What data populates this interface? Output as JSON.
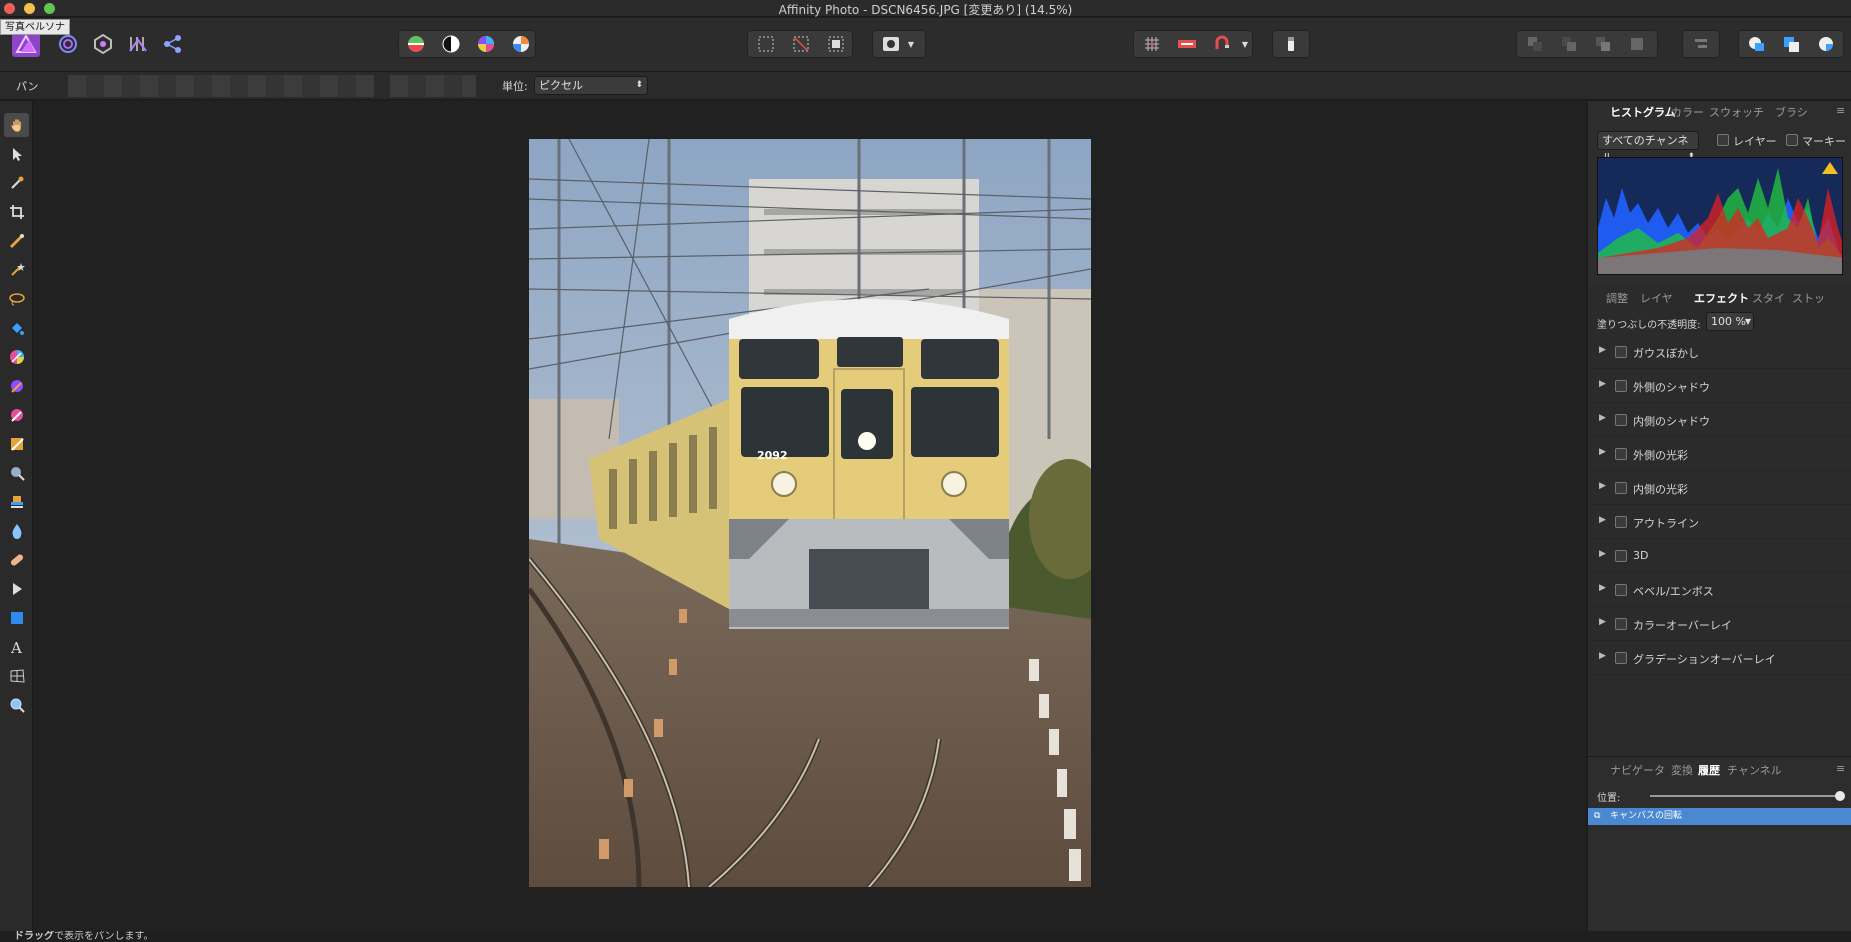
{
  "window": {
    "title": "Affinity Photo - DSCN6456.JPG [変更あり] (14.5%)",
    "tooltip": "写真ペルソナ",
    "colors": {
      "close": "#ec5f56",
      "minimize": "#f4bf4f",
      "maximize": "#61c554",
      "accent": "#4a90d9"
    }
  },
  "toolbar": {
    "persona_icons": [
      "photo-persona-icon",
      "liquify-persona-icon",
      "develop-persona-icon",
      "tone-mapping-persona-icon",
      "export-persona-icon"
    ],
    "adjust_icons": [
      "auto-levels-icon",
      "auto-contrast-icon",
      "auto-colors-icon",
      "auto-white-balance-icon"
    ],
    "selection_icons": [
      "select-all-icon",
      "deselect-icon",
      "invert-selection-icon"
    ],
    "mask_icons": [
      "quick-mask-icon"
    ],
    "snapping_icons": [
      "grid-icon",
      "assistant-icon",
      "snapping-icon"
    ],
    "misc_icons": [
      "force-pixel-alignment-icon"
    ],
    "arrange_icons": [
      "move-to-back-icon",
      "move-back-icon",
      "move-forward-icon",
      "move-to-front-icon"
    ],
    "align_icons": [
      "align-icon"
    ],
    "boolean_icons": [
      "add-icon",
      "subtract-icon",
      "intersect-icon"
    ]
  },
  "context": {
    "mode": "パン",
    "unit_label": "単位:",
    "unit_value": "ピクセル"
  },
  "tools": [
    "hand-tool-icon",
    "move-tool-icon",
    "color-picker-tool-icon",
    "crop-tool-icon",
    "selection-brush-tool-icon",
    "flood-select-tool-icon",
    "freehand-selection-tool-icon",
    "flood-fill-tool-icon",
    "paint-brush-tool-icon",
    "color-replacement-tool-icon",
    "pixel-tool-icon",
    "paint-mixer-brush-icon",
    "dodge-tool-icon",
    "clone-tool-icon",
    "blur-brush-icon",
    "healing-brush-icon",
    "node-tool-icon",
    "rectangle-tool-icon",
    "text-tool-icon",
    "mesh-warp-tool-icon",
    "zoom-tool-icon"
  ],
  "histogram_panel": {
    "tabs": [
      "ヒストグラム",
      "カラー",
      "スウォッチ",
      "ブラシ"
    ],
    "active_tab": 0,
    "channel_select": "すべてのチャンネル",
    "layer_check": "レイヤー",
    "marquee_check": "マーキー"
  },
  "effects_panel": {
    "tabs": [
      "調整",
      "レイヤ",
      "エフェクト",
      "スタイ",
      "ストッ"
    ],
    "active_tab": 2,
    "opacity_label": "塗りつぶしの不透明度:",
    "opacity_value": "100 %",
    "effects": [
      "ガウスぼかし",
      "外側のシャドウ",
      "内側のシャドウ",
      "外側の光彩",
      "内側の光彩",
      "アウトライン",
      "3D",
      "ベベル/エンボス",
      "カラーオーバーレイ",
      "グラデーションオーバーレイ"
    ]
  },
  "history_panel": {
    "tabs": [
      "ナビゲータ",
      "変換",
      "履歴",
      "チャンネル"
    ],
    "active_tab": 2,
    "position_label": "位置:",
    "position_fraction": 1.0,
    "entries": [
      "キャンバスの回転"
    ]
  },
  "status": {
    "bold": "ドラッグ",
    "text": "で表示をパンします。"
  },
  "photo": {
    "train_number": "2092"
  }
}
